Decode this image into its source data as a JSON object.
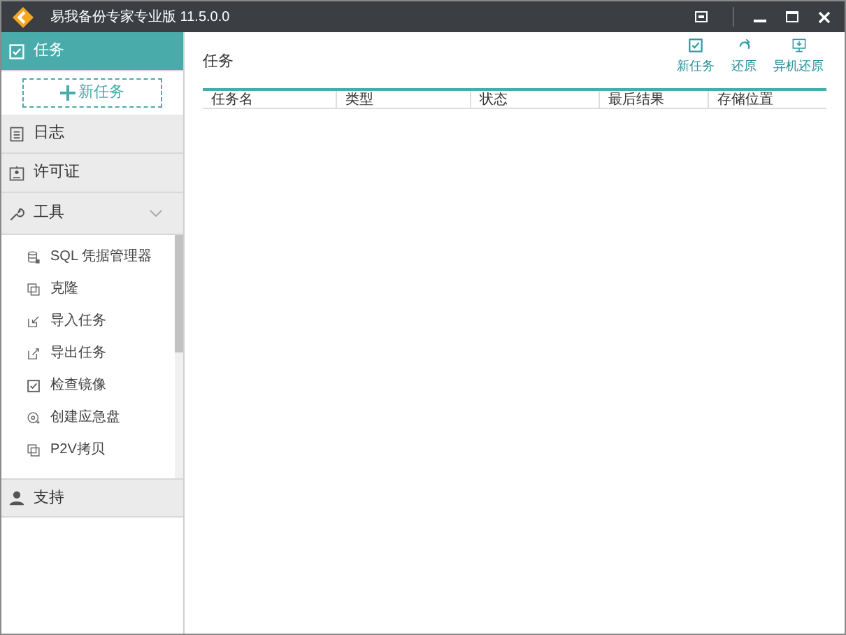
{
  "window": {
    "title": "易我备份专家专业版 11.5.0.0"
  },
  "sidebar": {
    "items": [
      {
        "kind": "nav",
        "label": "任务",
        "selected": true
      },
      {
        "kind": "new",
        "label": "新任务"
      },
      {
        "kind": "nav",
        "label": "日志",
        "selected": false
      },
      {
        "kind": "nav",
        "label": "许可证",
        "selected": false
      },
      {
        "kind": "group",
        "label": "工具",
        "expanded": true,
        "children": [
          {
            "label": "SQL 凭据管理器"
          },
          {
            "label": "克隆"
          },
          {
            "label": "导入任务"
          },
          {
            "label": "导出任务"
          },
          {
            "label": "检查镜像"
          },
          {
            "label": "创建应急盘"
          },
          {
            "label": "P2V拷贝"
          }
        ]
      },
      {
        "kind": "nav",
        "label": "支持",
        "selected": false
      }
    ]
  },
  "main": {
    "title": "任务",
    "toolbar": [
      {
        "label": "新任务"
      },
      {
        "label": "还原"
      },
      {
        "label": "异机还原"
      }
    ],
    "table": {
      "columns": [
        "任务名",
        "类型",
        "状态",
        "最后结果",
        "存储位置"
      ]
    }
  }
}
